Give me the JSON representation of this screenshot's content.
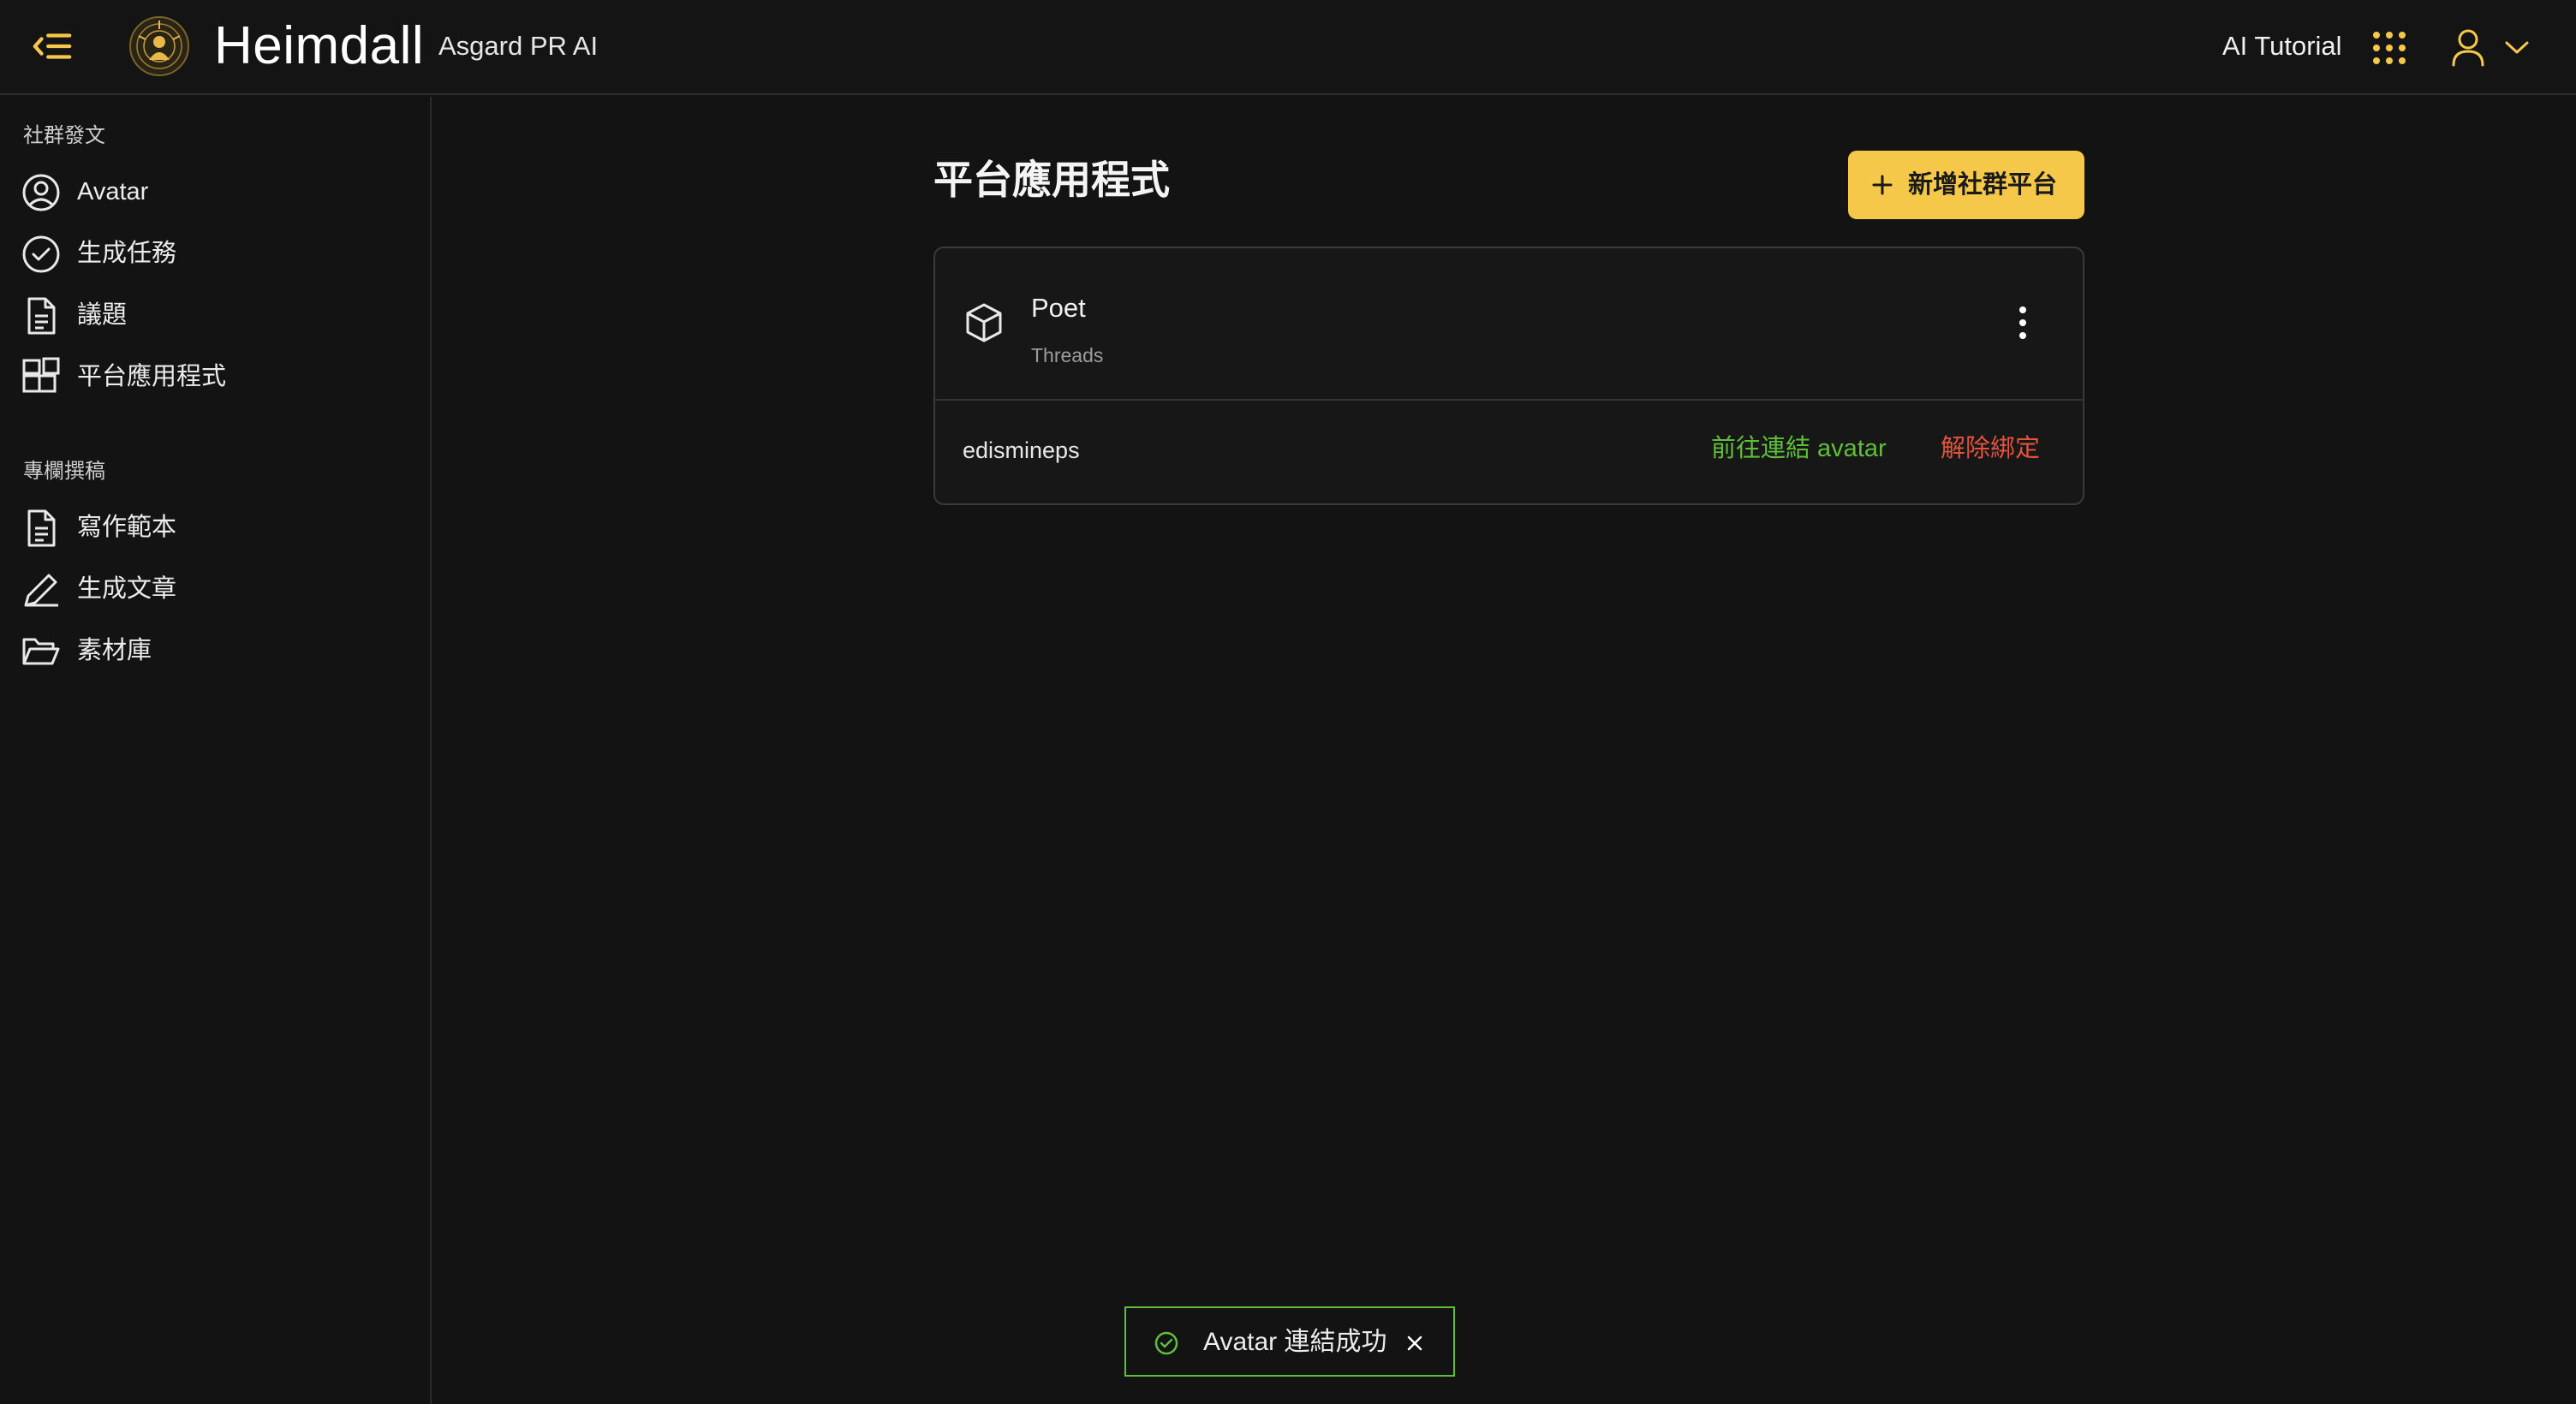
{
  "colors": {
    "accent": "#f5c84a",
    "success": "#5fbf3b",
    "danger": "#e3533e",
    "background": "#131313"
  },
  "header": {
    "title": "Heimdall",
    "subtitle": "Asgard PR AI",
    "tutorial_link": "AI Tutorial",
    "icons": [
      "menu-collapse-icon",
      "heimdall-logo",
      "apps-grid-icon",
      "user-icon",
      "chevron-down-icon"
    ]
  },
  "sidebar": {
    "sections": [
      {
        "label": "社群發文",
        "items": [
          {
            "label": "Avatar",
            "icon": "user-circle-icon"
          },
          {
            "label": "生成任務",
            "icon": "check-circle-icon"
          },
          {
            "label": "議題",
            "icon": "document-icon"
          },
          {
            "label": "平台應用程式",
            "icon": "apps-icon"
          }
        ]
      },
      {
        "label": "專欄撰稿",
        "items": [
          {
            "label": "寫作範本",
            "icon": "document-icon"
          },
          {
            "label": "生成文章",
            "icon": "pencil-icon"
          },
          {
            "label": "素材庫",
            "icon": "folder-open-icon"
          }
        ]
      }
    ]
  },
  "main": {
    "title": "平台應用程式",
    "add_button": "新增社群平台",
    "apps": [
      {
        "name": "Poet",
        "platform": "Threads",
        "icon": "package-icon",
        "account": "edismineps",
        "link_action": "前往連結 avatar",
        "unbind_action": "解除綁定"
      }
    ]
  },
  "toast": {
    "message": "Avatar 連結成功",
    "icon": "check-circle-icon"
  }
}
